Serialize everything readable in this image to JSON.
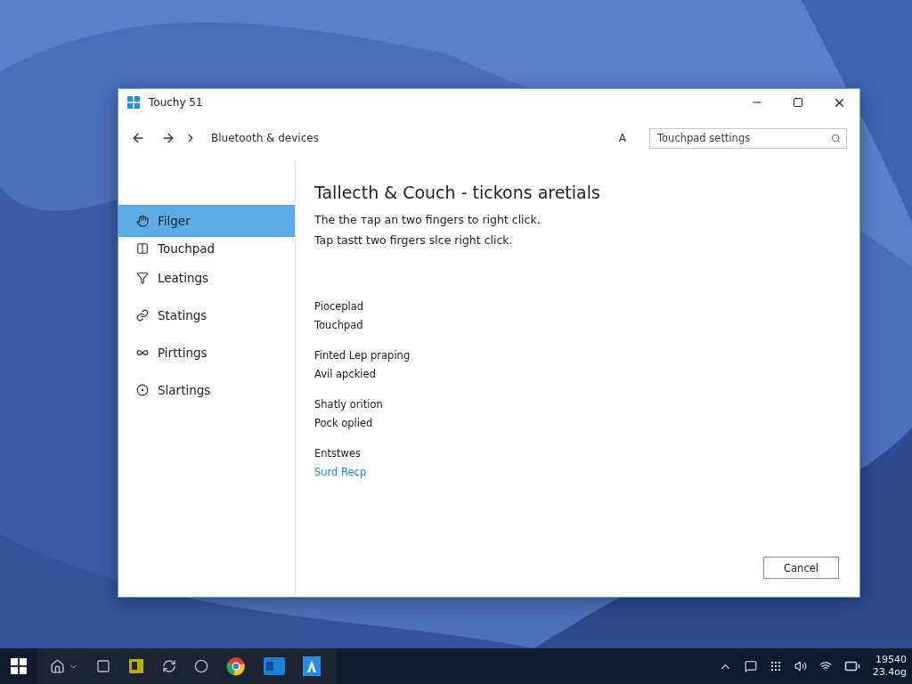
{
  "window": {
    "title": "Touchy 51"
  },
  "nav": {
    "breadcrumb": "Bluetooth & devices",
    "font_button": "A",
    "search": {
      "placeholder": "Touchpad settings"
    }
  },
  "sidebar": {
    "items": [
      {
        "label": "Filger",
        "selected": true
      },
      {
        "label": "Touchpad",
        "selected": false
      },
      {
        "label": "Leatings",
        "selected": false
      },
      {
        "label": "Statings",
        "selected": false
      },
      {
        "label": "Pirttings",
        "selected": false
      },
      {
        "label": "Slartings",
        "selected": false
      }
    ]
  },
  "content": {
    "heading": "Tallecth & Couch - tickons aretials",
    "description": [
      "The the тap an two fingers to right click.",
      "Tap tastt two firgers slce right click."
    ],
    "groups": [
      {
        "items": [
          {
            "kind": "label",
            "text": "Pioceplad"
          },
          {
            "kind": "label",
            "text": "Touchpad"
          }
        ]
      },
      {
        "items": [
          {
            "kind": "label",
            "text": "Finted Lep praping"
          },
          {
            "kind": "label",
            "text": "Avil apckied"
          }
        ]
      },
      {
        "items": [
          {
            "kind": "label",
            "text": "Shatly orition"
          },
          {
            "kind": "label",
            "text": "Pock oplied"
          }
        ]
      },
      {
        "items": [
          {
            "kind": "label",
            "text": "Entstwes"
          },
          {
            "kind": "link",
            "text": "Surd Recp"
          }
        ]
      }
    ]
  },
  "buttons": [
    {
      "label": "Cancel"
    }
  ],
  "taskbar": {
    "clock": {
      "time": "19540",
      "date": "23.4og"
    }
  }
}
